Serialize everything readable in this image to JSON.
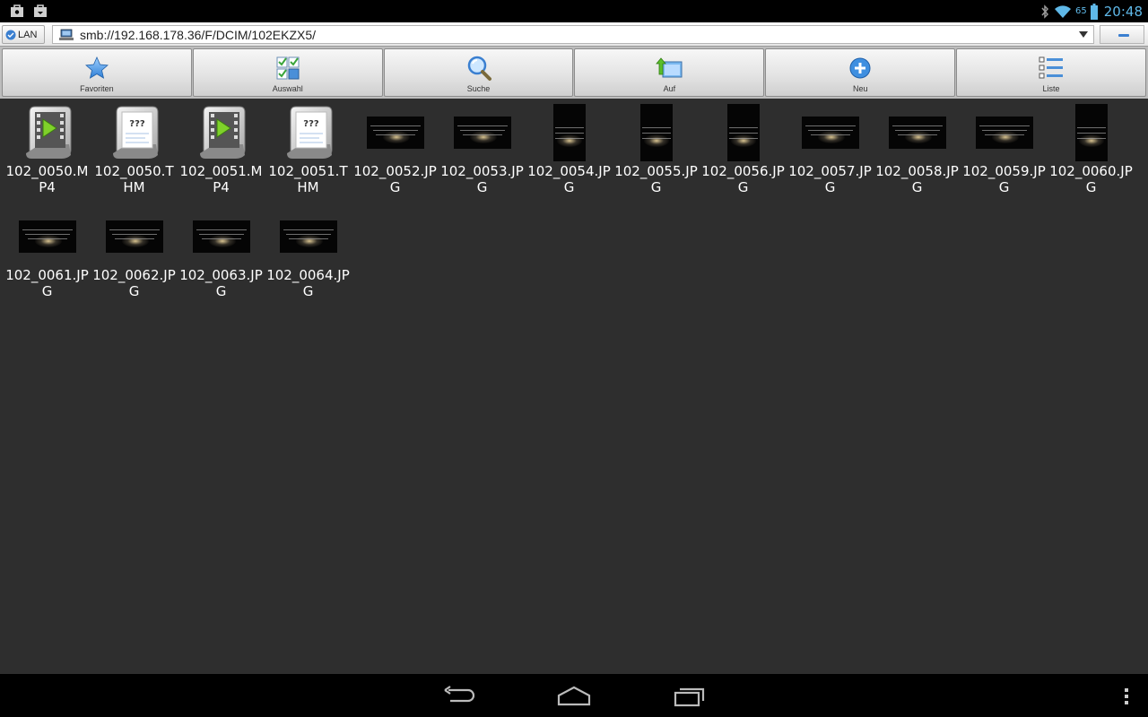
{
  "status_bar": {
    "notification_icons": [
      "shopping-bag-icon",
      "shopping-bag-icon"
    ],
    "battery_percent": "65",
    "time": "20:48",
    "accent_color": "#5fb8e8"
  },
  "address_bar": {
    "network_label": "LAN",
    "path": "smb://192.168.178.36/F/DCIM/102EKZX5/"
  },
  "toolbar": {
    "buttons": [
      {
        "label": "Favoriten",
        "icon": "star-icon"
      },
      {
        "label": "Auswahl",
        "icon": "select-grid-icon"
      },
      {
        "label": "Suche",
        "icon": "magnifier-icon"
      },
      {
        "label": "Auf",
        "icon": "folder-up-icon"
      },
      {
        "label": "Neu",
        "icon": "plus-circle-icon"
      },
      {
        "label": "Liste",
        "icon": "list-view-icon"
      }
    ]
  },
  "files": [
    {
      "name": "102_0050.MP4",
      "type": "video"
    },
    {
      "name": "102_0050.THM",
      "type": "unknown"
    },
    {
      "name": "102_0051.MP4",
      "type": "video"
    },
    {
      "name": "102_0051.THM",
      "type": "unknown"
    },
    {
      "name": "102_0052.JPG",
      "type": "photo-landscape"
    },
    {
      "name": "102_0053.JPG",
      "type": "photo-landscape"
    },
    {
      "name": "102_0054.JPG",
      "type": "photo-portrait"
    },
    {
      "name": "102_0055.JPG",
      "type": "photo-portrait"
    },
    {
      "name": "102_0056.JPG",
      "type": "photo-portrait"
    },
    {
      "name": "102_0057.JPG",
      "type": "photo-landscape"
    },
    {
      "name": "102_0058.JPG",
      "type": "photo-landscape"
    },
    {
      "name": "102_0059.JPG",
      "type": "photo-landscape"
    },
    {
      "name": "102_0060.JPG",
      "type": "photo-portrait"
    },
    {
      "name": "102_0061.JPG",
      "type": "photo-landscape"
    },
    {
      "name": "102_0062.JPG",
      "type": "photo-landscape"
    },
    {
      "name": "102_0063.JPG",
      "type": "photo-landscape"
    },
    {
      "name": "102_0064.JPG",
      "type": "photo-landscape"
    }
  ],
  "nav_bar": {
    "buttons": [
      "back-icon",
      "home-icon",
      "recent-apps-icon",
      "overflow-menu-icon"
    ]
  }
}
